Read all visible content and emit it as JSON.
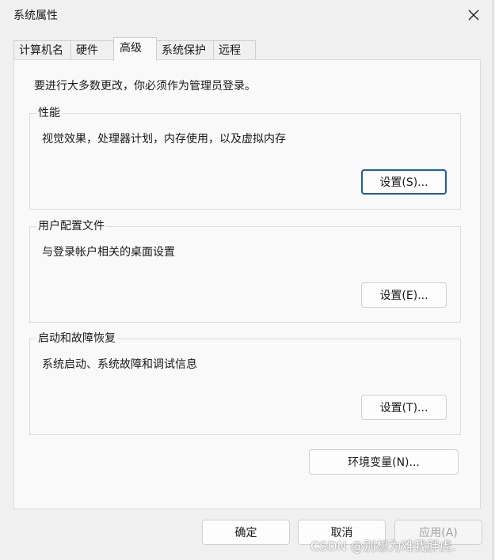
{
  "window": {
    "title": "系统属性"
  },
  "tabs": [
    {
      "label": "计算机名",
      "active": false
    },
    {
      "label": "硬件",
      "active": false
    },
    {
      "label": "高级",
      "active": true
    },
    {
      "label": "系统保护",
      "active": false
    },
    {
      "label": "远程",
      "active": false
    }
  ],
  "panel": {
    "admin_note": "要进行大多数更改，你必须作为管理员登录。",
    "groups": [
      {
        "title": "性能",
        "description": "视觉效果，处理器计划，内存使用，以及虚拟内存",
        "button": "设置(S)..."
      },
      {
        "title": "用户配置文件",
        "description": "与登录帐户相关的桌面设置",
        "button": "设置(E)..."
      },
      {
        "title": "启动和故障恢复",
        "description": "系统启动、系统故障和调试信息",
        "button": "设置(T)..."
      }
    ],
    "env_button": "环境变量(N)..."
  },
  "footer": {
    "ok": "确定",
    "cancel": "取消",
    "apply": "应用(A)"
  },
  "watermark": "CSDN @别想为难我胖虎.",
  "colors": {
    "focus_border": "#1e5fa8",
    "dialog_bg": "#f0f0f0",
    "panel_bg": "#f9f9f9"
  }
}
